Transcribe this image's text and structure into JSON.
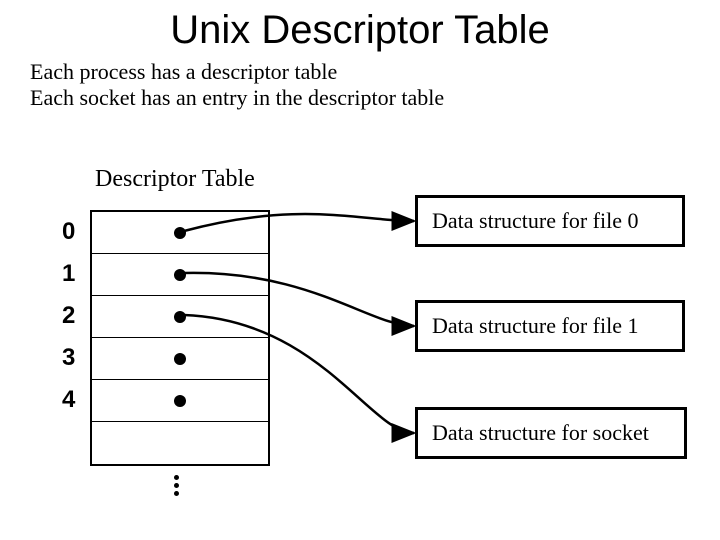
{
  "title": "Unix Descriptor Table",
  "subtext_line1": "Each process has a descriptor table",
  "subtext_line2": "Each socket has an entry in the descriptor table",
  "table_label": "Descriptor Table",
  "rows": {
    "r0": "0",
    "r1": "1",
    "r2": "2",
    "r3": "3",
    "r4": "4"
  },
  "boxes": {
    "file0": "Data structure for file 0",
    "file1": "Data structure for file 1",
    "socket": "Data structure for socket"
  }
}
